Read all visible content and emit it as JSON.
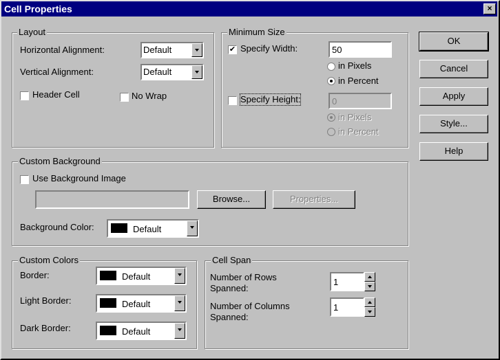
{
  "window": {
    "title": "Cell Properties",
    "close_label": "×"
  },
  "layout": {
    "group_label": "Layout",
    "horizontal_label": "Horizontal Alignment:",
    "horizontal_value": "Default",
    "vertical_label": "Vertical Alignment:",
    "vertical_value": "Default",
    "header_cell_label": "Header Cell",
    "header_cell_checked": false,
    "no_wrap_label": "No Wrap",
    "no_wrap_checked": false
  },
  "min_size": {
    "group_label": "Minimum Size",
    "specify_width_label": "Specify Width:",
    "specify_width_checked": true,
    "width_value": "50",
    "width_pixels_label": "in Pixels",
    "width_percent_label": "in Percent",
    "width_unit_selected": "in Percent",
    "specify_height_label": "Specify Height:",
    "specify_height_checked": false,
    "height_value": "0",
    "height_pixels_label": "in Pixels",
    "height_percent_label": "in Percent",
    "height_unit_selected": "in Pixels"
  },
  "background": {
    "group_label": "Custom Background",
    "use_image_label": "Use Background Image",
    "use_image_checked": false,
    "image_path": "",
    "browse_label": "Browse...",
    "properties_label": "Properties...",
    "color_label": "Background Color:",
    "color_value": "Default",
    "color_swatch": "#000000"
  },
  "custom_colors": {
    "group_label": "Custom Colors",
    "border_label": "Border:",
    "border_value": "Default",
    "light_border_label": "Light Border:",
    "light_border_value": "Default",
    "dark_border_label": "Dark Border:",
    "dark_border_value": "Default",
    "swatch_color": "#000000"
  },
  "cell_span": {
    "group_label": "Cell Span",
    "rows_label_1": "Number of Rows",
    "rows_label_2": "Spanned:",
    "rows_value": "1",
    "cols_label_1": "Number of Columns",
    "cols_label_2": "Spanned:",
    "cols_value": "1"
  },
  "buttons": {
    "ok": "OK",
    "cancel": "Cancel",
    "apply": "Apply",
    "style": "Style...",
    "help": "Help"
  },
  "colors": {
    "title_bar": "#000080",
    "face": "#c0c0c0"
  }
}
